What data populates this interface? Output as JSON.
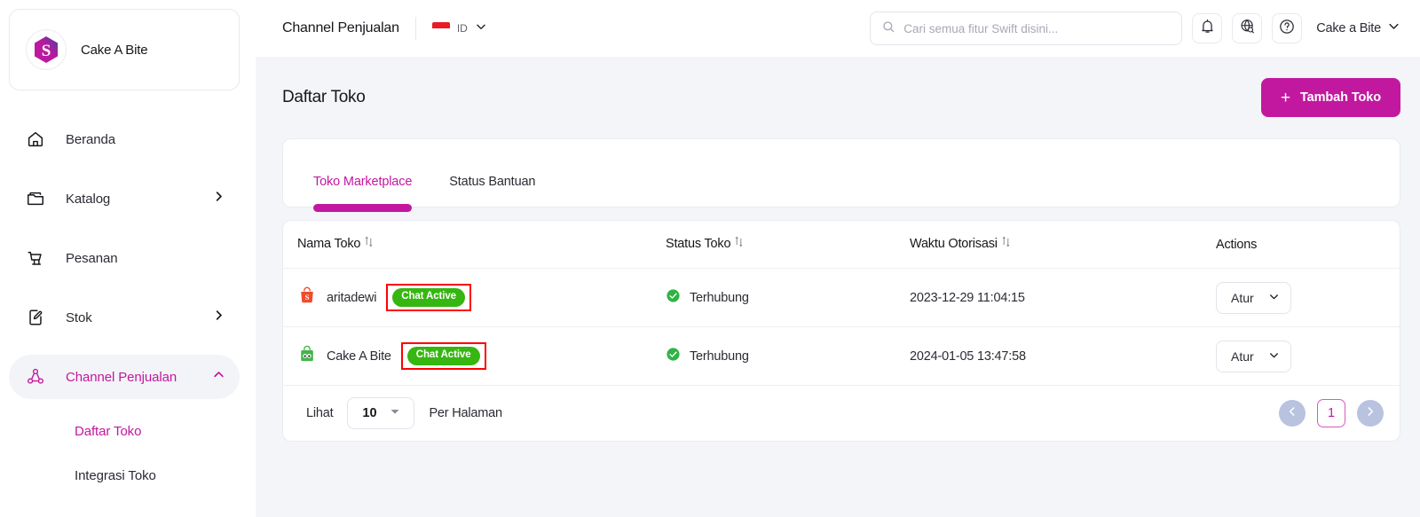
{
  "colors": {
    "brand_pink": "#c2189f",
    "badge_green": "#36b611",
    "status_green": "#2fb344",
    "highlight_red": "#ff0000",
    "shopee_orange": "#ee4d2d",
    "tokopedia_green": "#42b549"
  },
  "sidebar": {
    "brand": {
      "name": "Cake A Bite",
      "logo_icon": "swift-hexagon-logo"
    },
    "items": [
      {
        "label": "Beranda",
        "icon": "home-icon",
        "has_chevron": false,
        "active": false
      },
      {
        "label": "Katalog",
        "icon": "folder-icon",
        "has_chevron": true,
        "chevron": "chevron-right-icon",
        "active": false
      },
      {
        "label": "Pesanan",
        "icon": "cart-icon",
        "has_chevron": false,
        "active": false
      },
      {
        "label": "Stok",
        "icon": "document-edit-icon",
        "has_chevron": true,
        "chevron": "chevron-right-icon",
        "active": false
      },
      {
        "label": "Channel Penjualan",
        "icon": "network-nodes-icon",
        "has_chevron": true,
        "chevron": "chevron-up-icon",
        "active": true
      }
    ],
    "subitems": [
      {
        "label": "Daftar Toko",
        "active": true
      },
      {
        "label": "Integrasi Toko",
        "active": false
      }
    ]
  },
  "topbar": {
    "page_title": "Channel Penjualan",
    "language": {
      "code": "ID",
      "flag_icon": "indonesia-flag-icon",
      "chevron": "chevron-down-icon"
    },
    "search": {
      "placeholder": "Cari semua fitur Swift disini...",
      "value": "",
      "icon": "search-icon"
    },
    "actions": [
      {
        "name": "notifications-button",
        "icon": "bell-icon"
      },
      {
        "name": "language-globe-button",
        "icon": "globe-search-icon"
      },
      {
        "name": "help-button",
        "icon": "question-circle-icon"
      }
    ],
    "user": {
      "name": "Cake a Bite",
      "chevron": "chevron-down-icon"
    }
  },
  "content": {
    "title": "Daftar Toko",
    "add_button": {
      "label": "Tambah Toko",
      "icon": "plus-icon"
    },
    "tabs": [
      {
        "label": "Toko Marketplace",
        "active": true
      },
      {
        "label": "Status Bantuan",
        "active": false
      }
    ],
    "table": {
      "columns": [
        {
          "label": "Nama Toko",
          "sortable": true
        },
        {
          "label": "Status Toko",
          "sortable": true
        },
        {
          "label": "Waktu Otorisasi",
          "sortable": true
        },
        {
          "label": "Actions",
          "sortable": false
        }
      ],
      "rows": [
        {
          "store_icon": "shopee-icon",
          "store_name": "aritadewi",
          "badge": "Chat Active",
          "badge_highlighted": true,
          "status": "Terhubung",
          "status_icon": "check-circle-icon",
          "auth_time": "2023-12-29 11:04:15",
          "action_label": "Atur",
          "action_chevron": "chevron-down-icon"
        },
        {
          "store_icon": "tokopedia-icon",
          "store_name": "Cake A Bite",
          "badge": "Chat Active",
          "badge_highlighted": true,
          "status": "Terhubung",
          "status_icon": "check-circle-icon",
          "auth_time": "2024-01-05 13:47:58",
          "action_label": "Atur",
          "action_chevron": "chevron-down-icon"
        }
      ]
    },
    "pagination": {
      "prefix_label": "Lihat",
      "per_page_value": "10",
      "suffix_label": "Per Halaman",
      "prev_icon": "chevron-left-icon",
      "next_icon": "chevron-right-icon",
      "current_page": "1"
    }
  }
}
